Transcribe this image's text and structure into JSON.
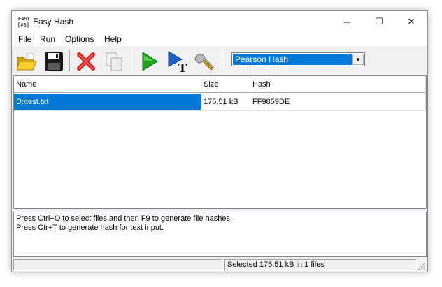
{
  "window": {
    "title": "Easy Hash",
    "icon": "easy-hash-app-icon",
    "controls": {
      "minimize": "─",
      "maximize": "☐",
      "close": "✕"
    }
  },
  "menu": [
    "File",
    "Run",
    "Options",
    "Help"
  ],
  "toolbar": {
    "buttons": [
      {
        "name": "open-files",
        "icon": "folder-open-icon"
      },
      {
        "name": "save",
        "icon": "floppy-disk-icon"
      },
      {
        "name": "remove",
        "icon": "red-x-icon"
      },
      {
        "name": "copy",
        "icon": "copy-pages-icon"
      },
      {
        "name": "generate",
        "icon": "green-play-icon"
      },
      {
        "name": "text-hash",
        "icon": "blue-arrow-t-icon"
      },
      {
        "name": "settings",
        "icon": "wrench-icon"
      }
    ],
    "algorithm": {
      "selected": "Pearson Hash"
    }
  },
  "list": {
    "columns": [
      "Name",
      "Size",
      "Hash"
    ],
    "rows": [
      {
        "name": "D:\\test.txt",
        "size": "175,51 kB",
        "hash": "FF9859DE",
        "selected": true
      }
    ]
  },
  "log": [
    "Press Ctrl+O to select files and then F9 to generate file hashes.",
    "Press Ctr+T to generate hash for text input."
  ],
  "status": {
    "left": "",
    "right": "Selected 175,51 kB in 1 files"
  },
  "colors": {
    "selection": "#0078d7",
    "window_bg": "#f0f0f0"
  }
}
